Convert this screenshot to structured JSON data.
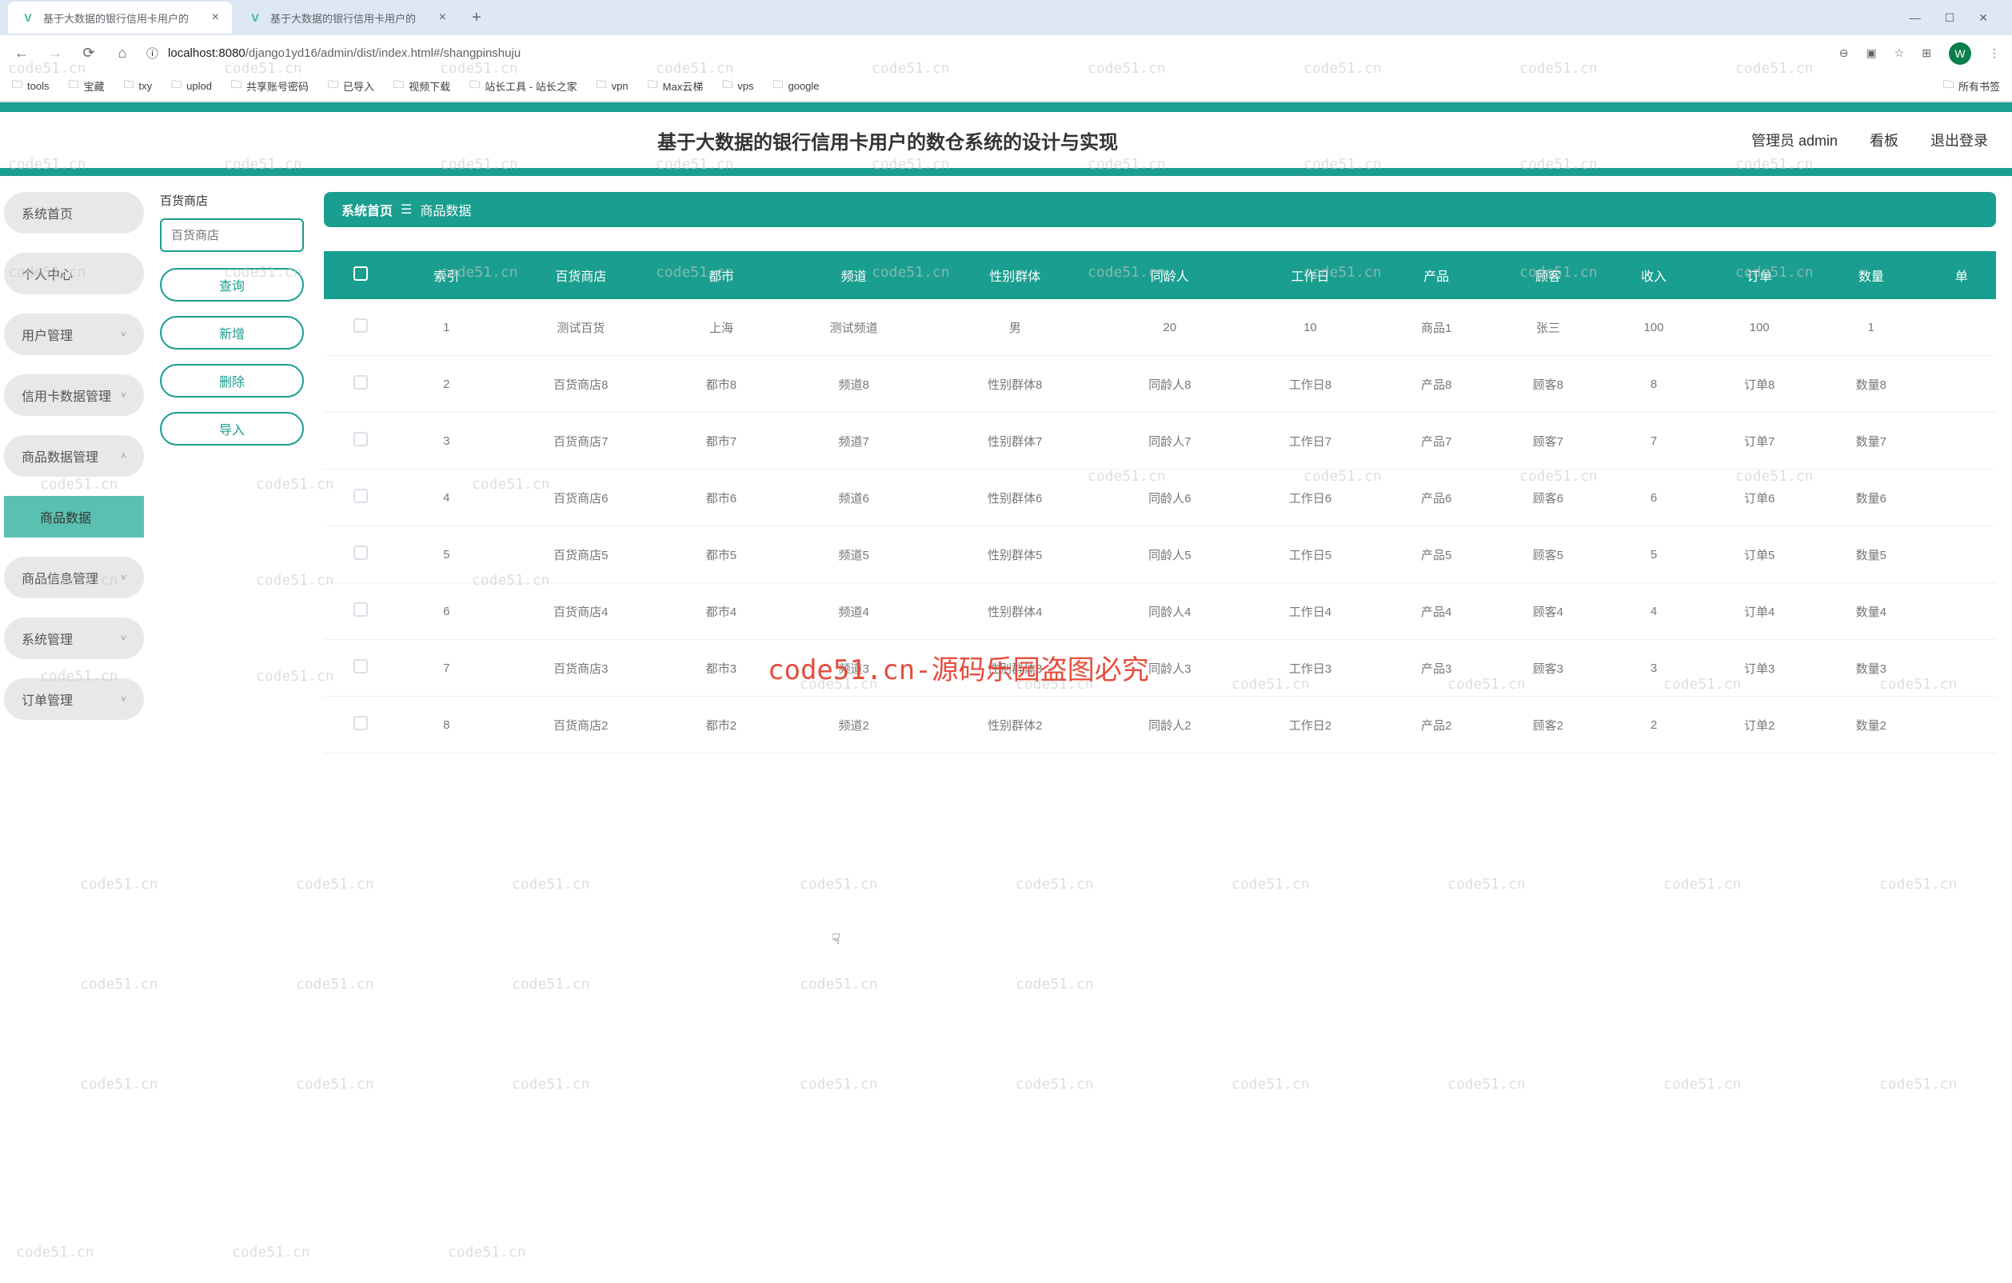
{
  "browser": {
    "tabs": [
      {
        "title": "基于大数据的银行信用卡用户的",
        "active": true
      },
      {
        "title": "基于大数据的银行信用卡用户的",
        "active": false
      }
    ],
    "url_info_icon": "ⓘ",
    "url_host": "localhost:8080",
    "url_path": "/django1yd16/admin/dist/index.html#/shangpinshuju",
    "bookmarks": [
      "tools",
      "宝藏",
      "txy",
      "uplod",
      "共享账号密码",
      "已导入",
      "视频下载",
      "站长工具 - 站长之家",
      "vpn",
      "Max云梯",
      "vps",
      "google"
    ],
    "bookmarks_right": "所有书签",
    "profile_letter": "W"
  },
  "header": {
    "title": "基于大数据的银行信用卡用户的数仓系统的设计与实现",
    "admin_label": "管理员 admin",
    "kanban": "看板",
    "logout": "退出登录"
  },
  "sidebar": {
    "items": [
      {
        "label": "系统首页",
        "sub": false,
        "chev": false
      },
      {
        "label": "个人中心",
        "sub": false,
        "chev": false
      },
      {
        "label": "用户管理",
        "sub": false,
        "chev": true
      },
      {
        "label": "信用卡数据管理",
        "sub": false,
        "chev": true
      },
      {
        "label": "商品数据管理",
        "sub": false,
        "chev": true,
        "open": true
      },
      {
        "label": "商品数据",
        "sub": true,
        "active": true
      },
      {
        "label": "商品信息管理",
        "sub": false,
        "chev": true
      },
      {
        "label": "系统管理",
        "sub": false,
        "chev": true
      },
      {
        "label": "订单管理",
        "sub": false,
        "chev": true
      }
    ]
  },
  "filter": {
    "label": "百货商店",
    "placeholder": "百货商店",
    "buttons": [
      "查询",
      "新增",
      "删除",
      "导入"
    ]
  },
  "breadcrumb": {
    "home": "系统首页",
    "sep": "☰",
    "current": "商品数据"
  },
  "table": {
    "headers": [
      "",
      "索引",
      "百货商店",
      "都市",
      "频道",
      "性别群体",
      "同龄人",
      "工作日",
      "产品",
      "顾客",
      "收入",
      "订单",
      "数量",
      "单"
    ],
    "rows": [
      [
        "",
        "1",
        "测试百货",
        "上海",
        "测试频道",
        "男",
        "20",
        "10",
        "商品1",
        "张三",
        "100",
        "100",
        "1",
        ""
      ],
      [
        "",
        "2",
        "百货商店8",
        "都市8",
        "频道8",
        "性别群体8",
        "同龄人8",
        "工作日8",
        "产品8",
        "顾客8",
        "8",
        "订单8",
        "数量8",
        ""
      ],
      [
        "",
        "3",
        "百货商店7",
        "都市7",
        "频道7",
        "性别群体7",
        "同龄人7",
        "工作日7",
        "产品7",
        "顾客7",
        "7",
        "订单7",
        "数量7",
        ""
      ],
      [
        "",
        "4",
        "百货商店6",
        "都市6",
        "频道6",
        "性别群体6",
        "同龄人6",
        "工作日6",
        "产品6",
        "顾客6",
        "6",
        "订单6",
        "数量6",
        ""
      ],
      [
        "",
        "5",
        "百货商店5",
        "都市5",
        "频道5",
        "性别群体5",
        "同龄人5",
        "工作日5",
        "产品5",
        "顾客5",
        "5",
        "订单5",
        "数量5",
        ""
      ],
      [
        "",
        "6",
        "百货商店4",
        "都市4",
        "频道4",
        "性别群体4",
        "同龄人4",
        "工作日4",
        "产品4",
        "顾客4",
        "4",
        "订单4",
        "数量4",
        ""
      ],
      [
        "",
        "7",
        "百货商店3",
        "都市3",
        "频道3",
        "性别群体3",
        "同龄人3",
        "工作日3",
        "产品3",
        "顾客3",
        "3",
        "订单3",
        "数量3",
        ""
      ],
      [
        "",
        "8",
        "百货商店2",
        "都市2",
        "频道2",
        "性别群体2",
        "同龄人2",
        "工作日2",
        "产品2",
        "顾客2",
        "2",
        "订单2",
        "数量2",
        ""
      ]
    ]
  },
  "watermark": {
    "text": "code51.cn",
    "center": "code51.cn-源码乐园盗图必究"
  }
}
